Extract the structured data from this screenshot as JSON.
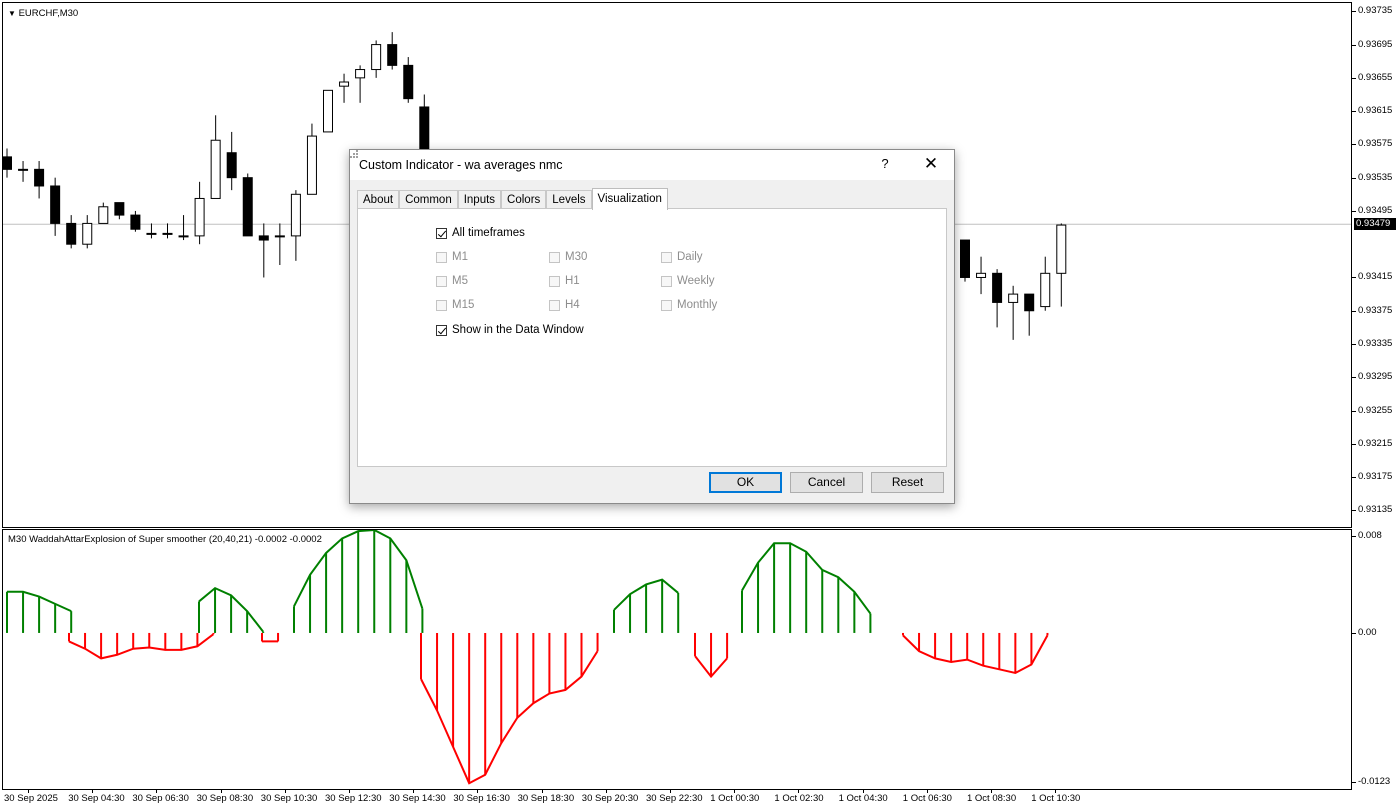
{
  "chart": {
    "symbol_title": "EURCHF,M30",
    "current_price": "0.93479",
    "price_labels": [
      "0.93735",
      "0.93695",
      "0.93655",
      "0.93615",
      "0.93575",
      "0.93535",
      "0.93495",
      "0.93415",
      "0.93375",
      "0.93335",
      "0.93295",
      "0.93255",
      "0.93215",
      "0.93175",
      "0.93135"
    ],
    "time_labels": [
      "30 Sep 2025",
      "30 Sep 04:30",
      "30 Sep 06:30",
      "30 Sep 08:30",
      "30 Sep 10:30",
      "30 Sep 12:30",
      "30 Sep 14:30",
      "30 Sep 16:30",
      "30 Sep 18:30",
      "30 Sep 20:30",
      "30 Sep 22:30",
      "1 Oct 00:30",
      "1 Oct 02:30",
      "1 Oct 04:30",
      "1 Oct 06:30",
      "1 Oct 08:30",
      "1 Oct 10:30"
    ],
    "colors": {
      "bull_body": "#ffffff",
      "bear_body": "#000000",
      "wick": "#000000",
      "grid_line": "#c0c0c0"
    }
  },
  "indicator": {
    "title": "M30  WaddahAttarExplosion of Super smoother (20,40,21) -0.0002 -0.0002",
    "axis_labels": [
      "0.008",
      "0.00",
      "-0.0123"
    ],
    "colors": {
      "up": "#008000",
      "down": "#ff0000"
    }
  },
  "chart_data": [
    {
      "type": "candlestick",
      "title": "EURCHF,M30",
      "ylim": [
        0.93115,
        0.93745
      ],
      "candles": [
        {
          "o": 0.9356,
          "h": 0.9357,
          "l": 0.93535,
          "c": 0.93545
        },
        {
          "o": 0.93545,
          "h": 0.93555,
          "l": 0.9353,
          "c": 0.93545
        },
        {
          "o": 0.93545,
          "h": 0.93555,
          "l": 0.9351,
          "c": 0.93525
        },
        {
          "o": 0.93525,
          "h": 0.93535,
          "l": 0.93465,
          "c": 0.9348
        },
        {
          "o": 0.9348,
          "h": 0.9349,
          "l": 0.9345,
          "c": 0.93455
        },
        {
          "o": 0.93455,
          "h": 0.9349,
          "l": 0.9345,
          "c": 0.9348
        },
        {
          "o": 0.9348,
          "h": 0.93505,
          "l": 0.9348,
          "c": 0.935
        },
        {
          "o": 0.93505,
          "h": 0.93505,
          "l": 0.93485,
          "c": 0.9349
        },
        {
          "o": 0.9349,
          "h": 0.93495,
          "l": 0.9347,
          "c": 0.93473
        },
        {
          "o": 0.93468,
          "h": 0.9348,
          "l": 0.93462,
          "c": 0.93468
        },
        {
          "o": 0.93468,
          "h": 0.9348,
          "l": 0.93462,
          "c": 0.93468
        },
        {
          "o": 0.93465,
          "h": 0.9349,
          "l": 0.9346,
          "c": 0.93465
        },
        {
          "o": 0.93465,
          "h": 0.9353,
          "l": 0.93455,
          "c": 0.9351
        },
        {
          "o": 0.9351,
          "h": 0.9361,
          "l": 0.9351,
          "c": 0.9358
        },
        {
          "o": 0.93565,
          "h": 0.9359,
          "l": 0.9352,
          "c": 0.93535
        },
        {
          "o": 0.93535,
          "h": 0.9354,
          "l": 0.93465,
          "c": 0.93465
        },
        {
          "o": 0.93465,
          "h": 0.9348,
          "l": 0.93415,
          "c": 0.9346
        },
        {
          "o": 0.93465,
          "h": 0.9348,
          "l": 0.9343,
          "c": 0.93465
        },
        {
          "o": 0.93465,
          "h": 0.9352,
          "l": 0.93435,
          "c": 0.93515
        },
        {
          "o": 0.93515,
          "h": 0.936,
          "l": 0.93515,
          "c": 0.93585
        },
        {
          "o": 0.9359,
          "h": 0.9364,
          "l": 0.9359,
          "c": 0.9364
        },
        {
          "o": 0.93645,
          "h": 0.9366,
          "l": 0.93625,
          "c": 0.9365
        },
        {
          "o": 0.93655,
          "h": 0.9367,
          "l": 0.93625,
          "c": 0.93665
        },
        {
          "o": 0.93665,
          "h": 0.937,
          "l": 0.93655,
          "c": 0.93695
        },
        {
          "o": 0.93695,
          "h": 0.9371,
          "l": 0.93665,
          "c": 0.9367
        },
        {
          "o": 0.9367,
          "h": 0.9368,
          "l": 0.93625,
          "c": 0.9363
        },
        {
          "o": 0.9362,
          "h": 0.93635,
          "l": 0.93555,
          "c": 0.9356
        },
        {
          "o": 0.9346,
          "h": 0.9346,
          "l": 0.9341,
          "c": 0.93415
        },
        {
          "o": 0.93415,
          "h": 0.9344,
          "l": 0.93395,
          "c": 0.9342
        },
        {
          "o": 0.9342,
          "h": 0.93425,
          "l": 0.93355,
          "c": 0.93385
        },
        {
          "o": 0.93385,
          "h": 0.93405,
          "l": 0.9334,
          "c": 0.93395
        },
        {
          "o": 0.93395,
          "h": 0.93395,
          "l": 0.93345,
          "c": 0.93375
        },
        {
          "o": 0.9338,
          "h": 0.9344,
          "l": 0.93375,
          "c": 0.9342
        },
        {
          "o": 0.9342,
          "h": 0.9348,
          "l": 0.9338,
          "c": 0.93478
        }
      ]
    },
    {
      "type": "bar",
      "title": "WaddahAttarExplosion of Super smoother (20,40,21)",
      "ylim": [
        -0.0123,
        0.008
      ],
      "series": [
        {
          "values": [
            0.0034,
            0.0034,
            0.003,
            0.0024,
            0.0018
          ]
        },
        {
          "values": [
            -0.0007,
            -0.0013,
            -0.0021,
            -0.0018,
            -0.0013,
            -0.0012,
            -0.0014,
            -0.0014,
            -0.0011,
            -0.0001
          ]
        },
        {
          "values": [
            0.0026,
            0.0037,
            0.0031,
            0.0018,
            0.0001
          ]
        },
        {
          "values": [
            -0.0007,
            -0.0007
          ]
        },
        {
          "values": [
            0.0022,
            0.0048,
            0.0066,
            0.0078,
            0.0084,
            0.0085,
            0.0078,
            0.006,
            0.002
          ]
        },
        {
          "values": [
            -0.0038,
            -0.0064,
            -0.0094,
            -0.0124,
            -0.0117,
            -0.0091,
            -0.007,
            -0.0058,
            -0.005,
            -0.0047,
            -0.0036,
            -0.0015
          ]
        },
        {
          "values": [
            0.0019,
            0.0032,
            0.004,
            0.0044,
            0.0033
          ]
        },
        {
          "values": [
            -0.0019,
            -0.0036,
            -0.0021
          ]
        },
        {
          "values": [
            0.0035,
            0.0058,
            0.0074,
            0.0074,
            0.0067,
            0.0052,
            0.0046,
            0.0034,
            0.0016
          ]
        },
        {
          "values": [
            -0.0002,
            -0.0015,
            -0.0021,
            -0.0024,
            -0.0022,
            -0.0027,
            -0.003,
            -0.0033,
            -0.0026,
            -0.0002
          ]
        }
      ]
    }
  ],
  "dialog": {
    "title": "Custom Indicator - wa averages nmc",
    "help": "?",
    "close": "✕",
    "tabs": [
      "About",
      "Common",
      "Inputs",
      "Colors",
      "Levels",
      "Visualization"
    ],
    "active_tab": "Visualization",
    "all_timeframes": {
      "label": "All timeframes",
      "checked": true
    },
    "timeframes": [
      {
        "label": "M1",
        "checked": false
      },
      {
        "label": "M30",
        "checked": false
      },
      {
        "label": "Daily",
        "checked": false
      },
      {
        "label": "M5",
        "checked": false
      },
      {
        "label": "H1",
        "checked": false
      },
      {
        "label": "Weekly",
        "checked": false
      },
      {
        "label": "M15",
        "checked": false
      },
      {
        "label": "H4",
        "checked": false
      },
      {
        "label": "Monthly",
        "checked": false
      }
    ],
    "data_window": {
      "label": "Show in the Data Window",
      "checked": true
    },
    "buttons": {
      "ok": "OK",
      "cancel": "Cancel",
      "reset": "Reset"
    }
  }
}
